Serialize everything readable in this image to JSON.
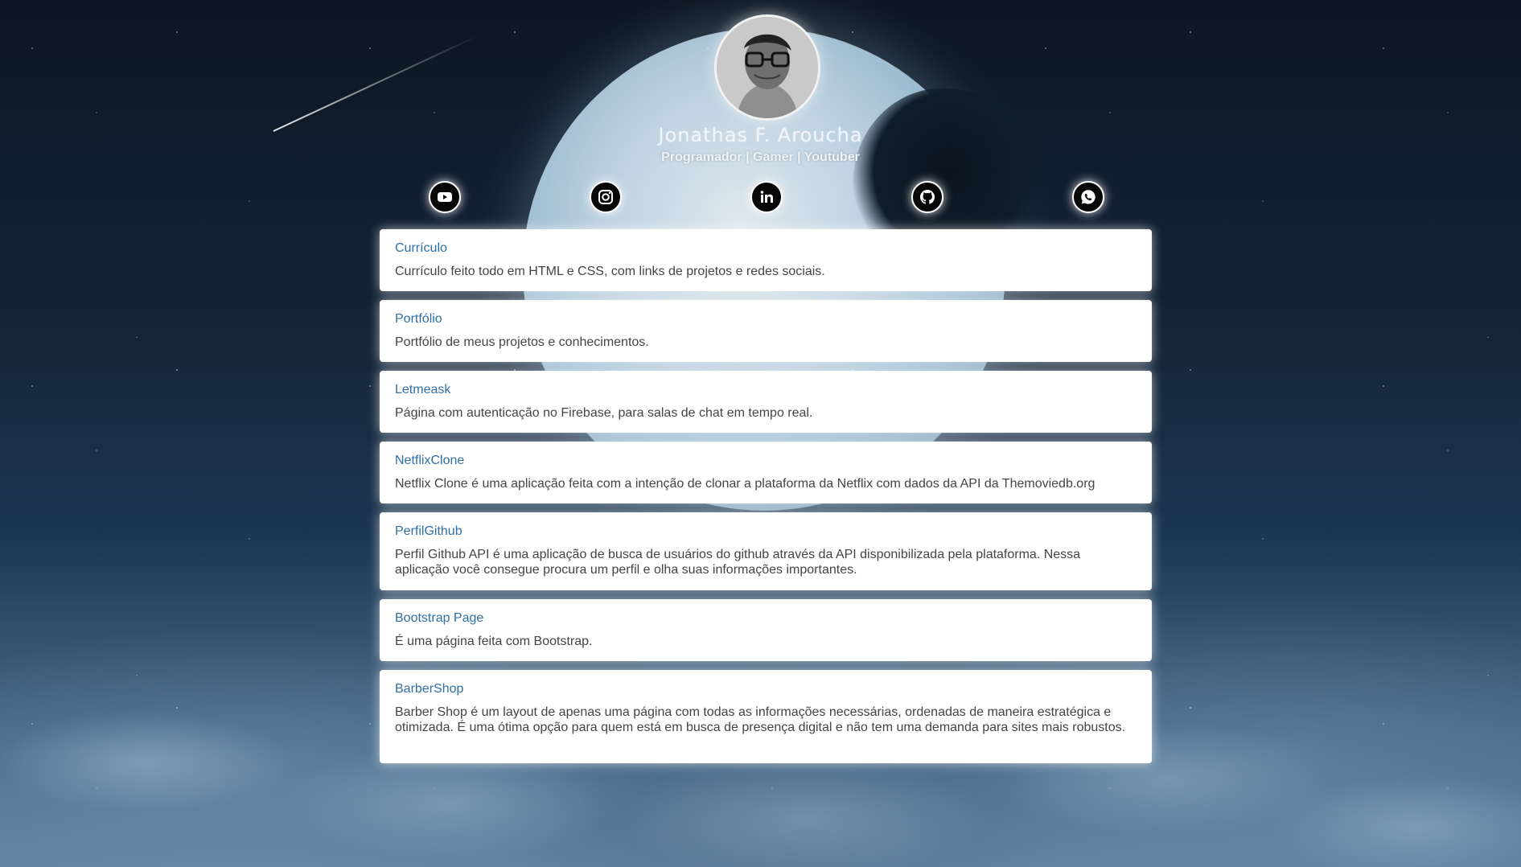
{
  "profile": {
    "name": "Jonathas F. Aroucha",
    "subtitle": "Programador | Gamer | Youtuber"
  },
  "social_links": [
    {
      "name": "youtube",
      "icon": "youtube-icon"
    },
    {
      "name": "instagram",
      "icon": "instagram-icon"
    },
    {
      "name": "linkedin",
      "icon": "linkedin-icon"
    },
    {
      "name": "github",
      "icon": "github-icon"
    },
    {
      "name": "whatsapp",
      "icon": "whatsapp-icon"
    }
  ],
  "projects": [
    {
      "title": "Currículo",
      "description": "Currículo feito todo em HTML e CSS, com links de projetos e redes sociais."
    },
    {
      "title": "Portfólio",
      "description": "Portfólio de meus projetos e conhecimentos."
    },
    {
      "title": "Letmeask",
      "description": "Página com autenticação no Firebase, para salas de chat em tempo real."
    },
    {
      "title": "NetflixClone",
      "description": "Netflix Clone é uma aplicação feita com a intenção de clonar a plataforma da Netflix com dados da API da Themoviedb.org"
    },
    {
      "title": "PerfilGithub",
      "description": "Perfil Github API é uma aplicação de busca de usuários do github através da API disponibilizada pela plataforma. Nessa aplicação você consegue procura um perfil e olha suas informações importantes."
    },
    {
      "title": "Bootstrap Page",
      "description": "É uma página feita com Bootstrap."
    },
    {
      "title": "BarberShop",
      "description": "Barber Shop é um layout de apenas uma página com todas as informações necessárias, ordenadas de maneira estratégica e otimizada. É uma ótima opção para quem está em busca de presença digital e não tem uma demanda para sites mais robustos."
    }
  ],
  "colors": {
    "link": "#2f6fa6",
    "text": "#444444",
    "card": "#ffffff",
    "icon_bg": "#070707"
  }
}
